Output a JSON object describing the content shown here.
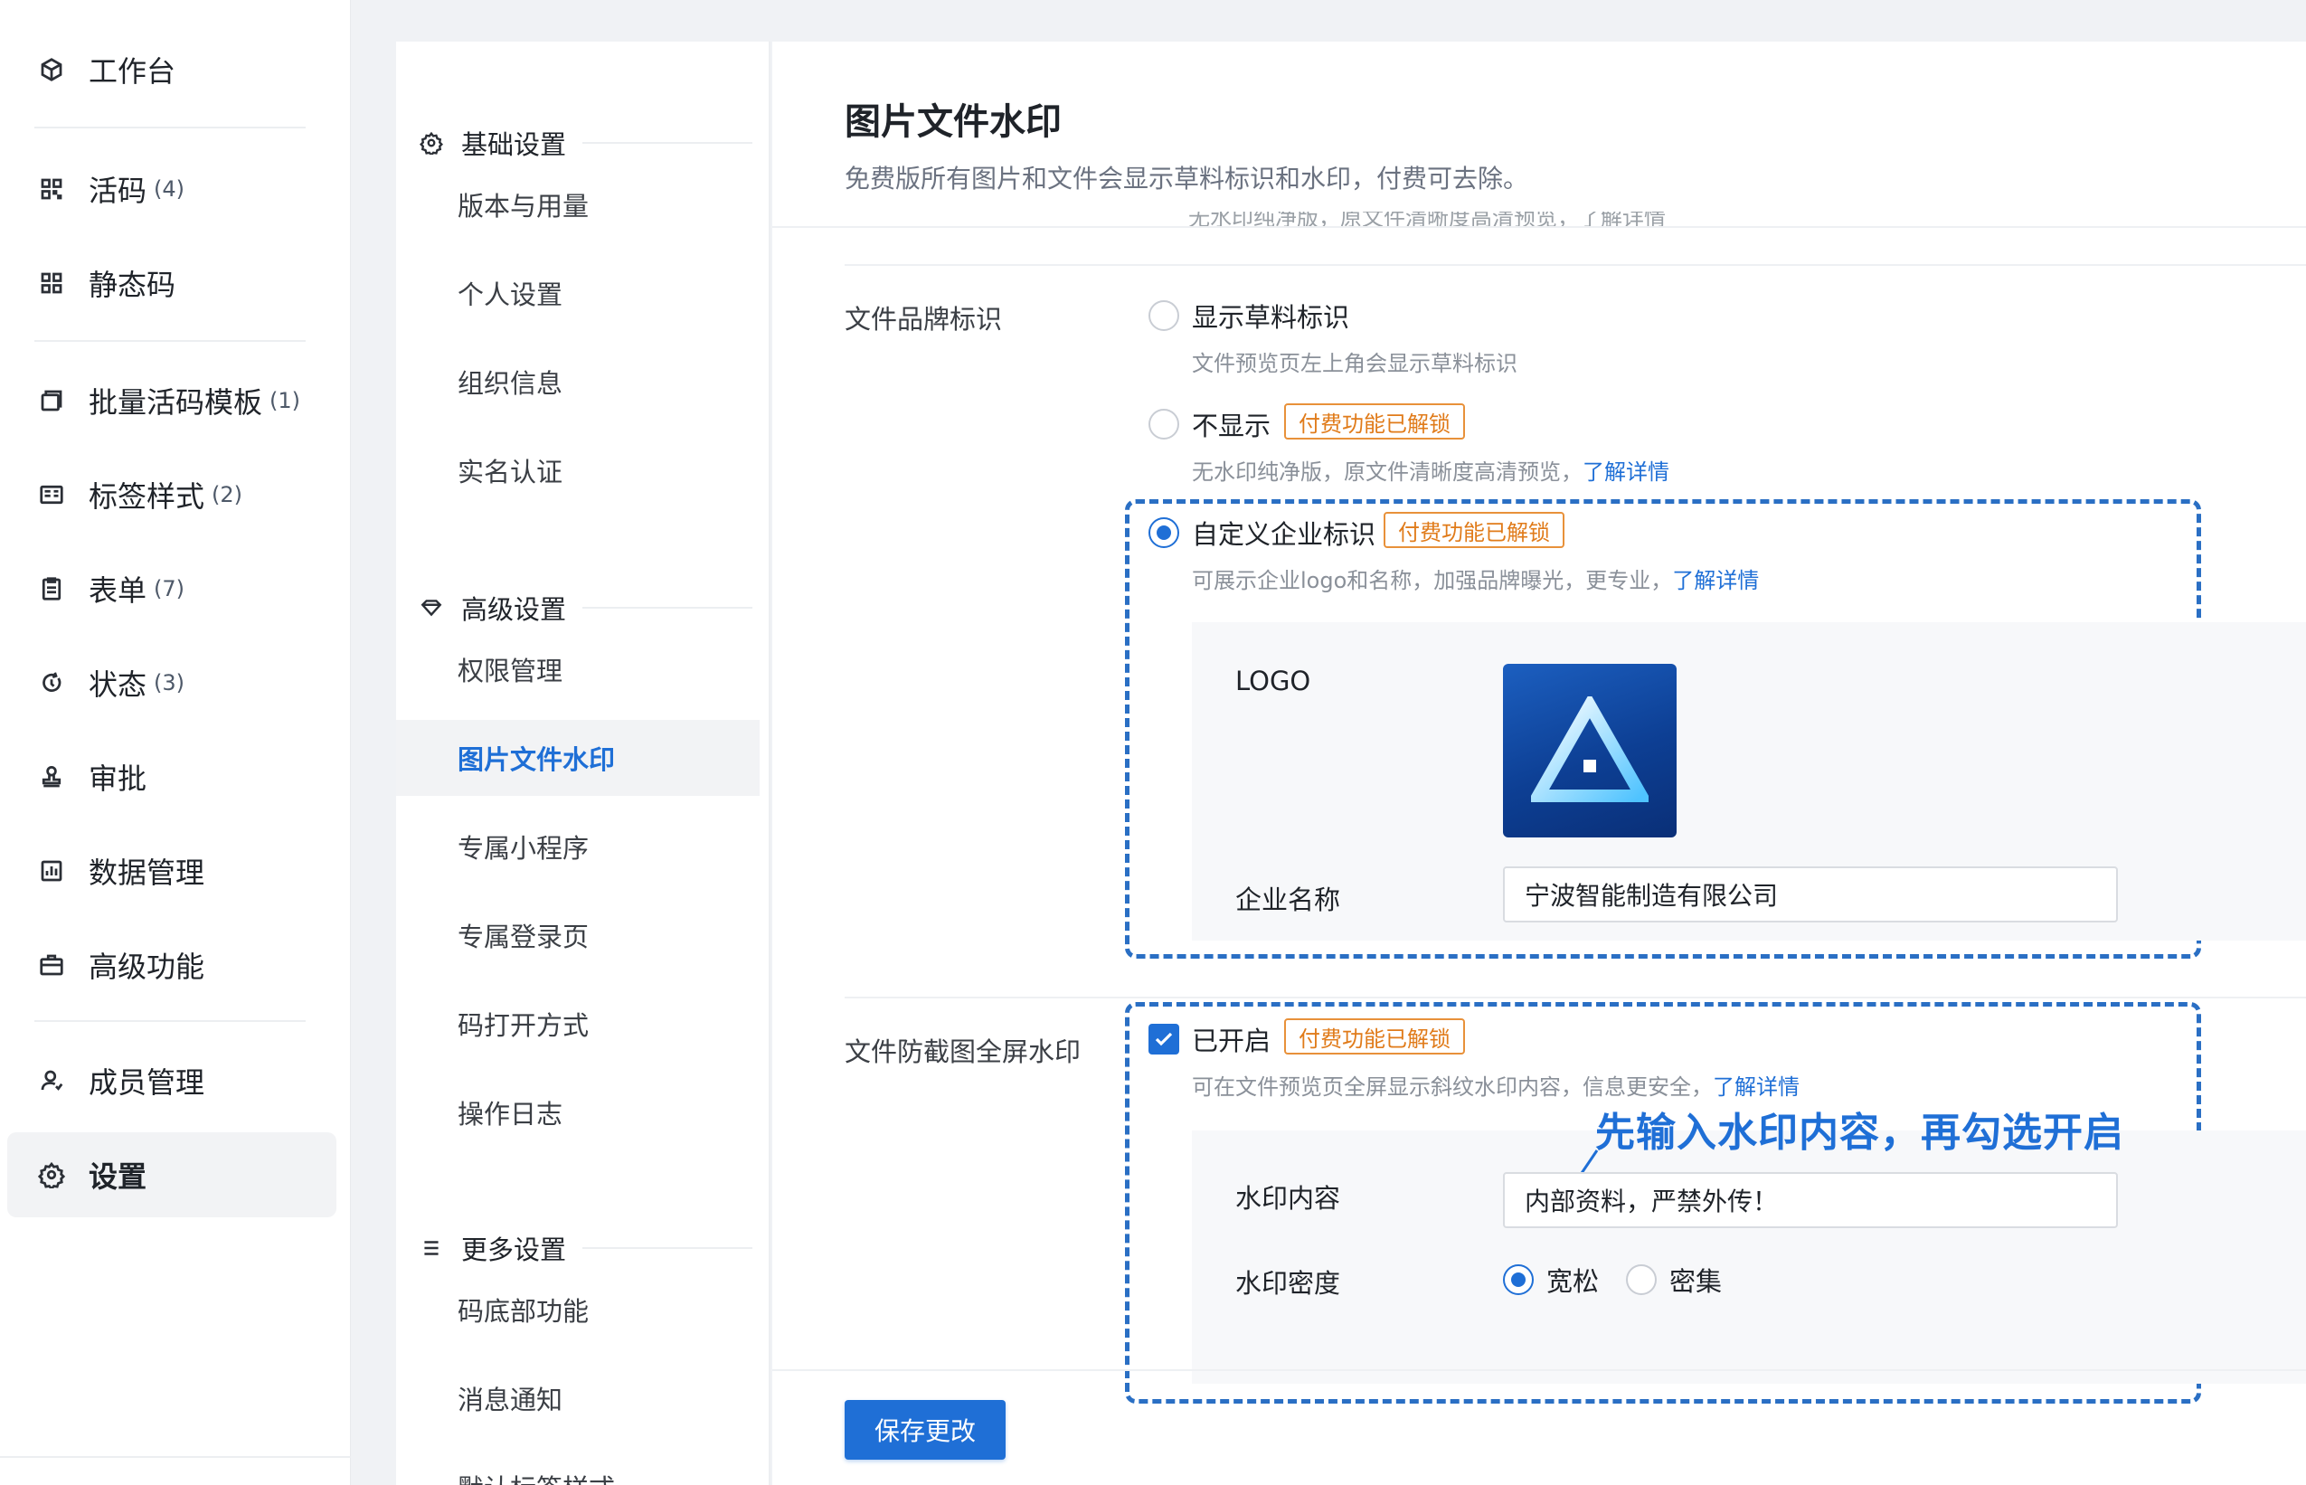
{
  "sidebar": {
    "items": [
      {
        "label": "工作台",
        "count": "",
        "icon": "cube-icon"
      },
      {
        "label": "活码",
        "count": "(4)",
        "icon": "qrcode-icon"
      },
      {
        "label": "静态码",
        "count": "",
        "icon": "static-qrcode-icon"
      },
      {
        "label": "批量活码模板",
        "count": "(1)",
        "icon": "template-icon"
      },
      {
        "label": "标签样式",
        "count": "(2)",
        "icon": "label-icon"
      },
      {
        "label": "表单",
        "count": "(7)",
        "icon": "form-icon"
      },
      {
        "label": "状态",
        "count": "(3)",
        "icon": "status-icon"
      },
      {
        "label": "审批",
        "count": "",
        "icon": "approval-stamp-icon"
      },
      {
        "label": "数据管理",
        "count": "",
        "icon": "chart-icon"
      },
      {
        "label": "高级功能",
        "count": "",
        "icon": "briefcase-icon"
      },
      {
        "label": "成员管理",
        "count": "",
        "icon": "member-icon"
      },
      {
        "label": "设置",
        "count": "",
        "icon": "gear-icon"
      }
    ]
  },
  "settings_nav": {
    "groups": [
      {
        "title": "基础设置",
        "icon": "gear-icon",
        "items": [
          "版本与用量",
          "个人设置",
          "组织信息",
          "实名认证"
        ]
      },
      {
        "title": "高级设置",
        "icon": "diamond-icon",
        "items": [
          "权限管理",
          "图片文件水印",
          "专属小程序",
          "专属登录页",
          "码打开方式",
          "操作日志"
        ]
      },
      {
        "title": "更多设置",
        "icon": "list-icon",
        "items": [
          "码底部功能",
          "消息通知",
          "默认标签样式"
        ]
      }
    ],
    "active": "图片文件水印"
  },
  "page": {
    "title": "图片文件水印",
    "subtitle": "免费版所有图片和文件会显示草料标识和水印，付费可去除。",
    "cut_text": "无水印纯净版，原文件清晰度高清预览，了解详情"
  },
  "brand": {
    "label": "文件品牌标识",
    "options": [
      {
        "label": "显示草料标识",
        "desc": "文件预览页左上角会显示草料标识",
        "link": "",
        "badge": ""
      },
      {
        "label": "不显示",
        "desc": "无水印纯净版，原文件清晰度高清预览，",
        "link": "了解详情",
        "badge": "付费功能已解锁"
      },
      {
        "label": "自定义企业标识",
        "desc": "可展示企业logo和名称，加强品牌曝光，更专业，",
        "link": "了解详情",
        "badge": "付费功能已解锁"
      }
    ],
    "selected": 2,
    "logo_label": "LOGO",
    "company_label": "企业名称",
    "company_value": "宁波智能制造有限公司"
  },
  "watermark": {
    "label": "文件防截图全屏水印",
    "checkbox_label": "已开启",
    "checked": true,
    "badge": "付费功能已解锁",
    "desc": "可在文件预览页全屏显示斜纹水印内容，信息更安全，",
    "link": "了解详情",
    "content_label": "水印内容",
    "content_value": "内部资料，严禁外传！",
    "density_label": "水印密度",
    "density_options": [
      "宽松",
      "密集"
    ],
    "density_selected": "宽松",
    "annotation": "先输入水印内容，再勾选开启"
  },
  "save_label": "保存更改",
  "colors": {
    "primary": "#1f6fd6",
    "badge": "#e07b1a",
    "annotation_border": "#2a6fc4"
  }
}
